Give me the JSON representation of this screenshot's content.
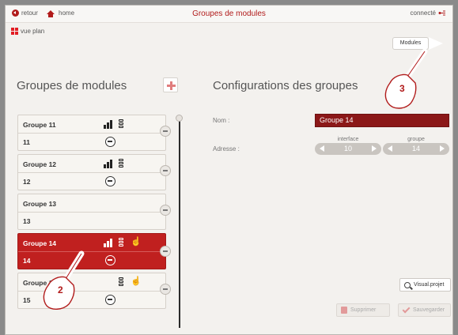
{
  "topbar": {
    "back_label": "retour",
    "home_label": "home",
    "title": "Groupes de modules",
    "status_label": "connecté"
  },
  "subbar": {
    "plan_label": "vue plan",
    "modules_label": "Modules"
  },
  "left": {
    "heading": "Groupes de modules",
    "groups": [
      {
        "name": "Groupe 11",
        "address": "11",
        "icons": [
          "chart-icon",
          "traffic-light-icon",
          "usb-icon"
        ]
      },
      {
        "name": "Groupe 12",
        "address": "12",
        "icons": [
          "chart-icon",
          "traffic-light-icon",
          "usb-icon"
        ]
      },
      {
        "name": "Groupe 13",
        "address": "13",
        "icons": []
      },
      {
        "name": "Groupe 14",
        "address": "14",
        "icons": [
          "chart-icon",
          "traffic-light-icon",
          "hand-icon",
          "usb-icon"
        ],
        "selected": true
      },
      {
        "name": "Groupe 15",
        "address": "15",
        "icons": [
          "traffic-light-icon",
          "hand-icon",
          "usb-icon"
        ]
      }
    ]
  },
  "right": {
    "heading": "Configurations des groupes",
    "name_label": "Nom :",
    "name_value": "Groupe 14",
    "address_label": "Adresse :",
    "interface_caption": "interface",
    "interface_value": "10",
    "group_caption": "groupe",
    "group_value": "14",
    "visual_button": "Visual.projet",
    "delete_button": "Supprimer",
    "save_button": "Sauvegarder"
  },
  "callouts": {
    "two": "2",
    "three": "3"
  },
  "colors": {
    "accent": "#b11b1b",
    "selected": "#c0201f",
    "input_bg": "#8b1818"
  }
}
